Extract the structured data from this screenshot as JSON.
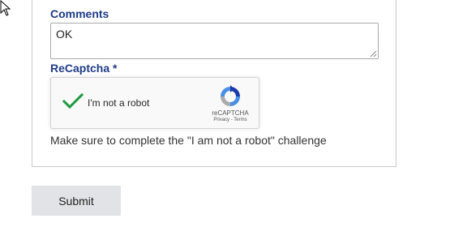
{
  "form": {
    "comments": {
      "label": "Comments",
      "value": "OK"
    },
    "recaptcha": {
      "label": "ReCaptcha *",
      "checkbox_label": "I'm not a robot",
      "checked": true,
      "brand": "reCAPTCHA",
      "links": "Privacy - Terms",
      "check_color": "#1e9b3f"
    },
    "hint": "Make sure to complete the \"I am not a robot\" challenge",
    "submit_label": "Submit"
  },
  "colors": {
    "label": "#1f3c88",
    "button_bg": "#e1e3e6"
  },
  "icons": [
    "mouse-cursor-icon",
    "checkmark-icon",
    "recaptcha-logo-icon",
    "resize-grip-icon"
  ]
}
